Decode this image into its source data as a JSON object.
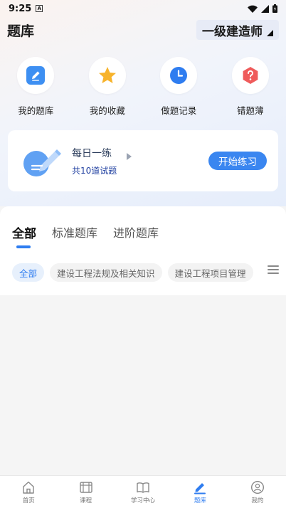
{
  "status_bar": {
    "time": "9:25",
    "notification_letter": "A"
  },
  "header": {
    "title": "题库",
    "level_select": "一级建造师"
  },
  "quick_actions": [
    {
      "label": "我的题库",
      "icon": "pencil-icon"
    },
    {
      "label": "我的收藏",
      "icon": "star-icon"
    },
    {
      "label": "做题记录",
      "icon": "clock-icon"
    },
    {
      "label": "错题薄",
      "icon": "question-icon"
    }
  ],
  "daily": {
    "title": "每日一练",
    "subtitle": "共10道试题",
    "button": "开始练习"
  },
  "bank_tabs": [
    {
      "label": "全部",
      "active": true
    },
    {
      "label": "标准题库",
      "active": false
    },
    {
      "label": "进阶题库",
      "active": false
    }
  ],
  "chips": [
    {
      "label": "全部",
      "active": true
    },
    {
      "label": "建设工程法规及相关知识",
      "active": false
    },
    {
      "label": "建设工程项目管理",
      "active": false
    }
  ],
  "tabbar": [
    {
      "label": "首页",
      "icon": "home-icon",
      "active": false
    },
    {
      "label": "课程",
      "icon": "video-icon",
      "active": false
    },
    {
      "label": "学习中心",
      "icon": "book-icon",
      "active": false
    },
    {
      "label": "题库",
      "icon": "edit-icon",
      "active": true
    },
    {
      "label": "我的",
      "icon": "user-icon",
      "active": false
    }
  ],
  "colors": {
    "accent": "#3a86f0",
    "quiz_blue": "#3d8ff2",
    "star": "#f7b32b",
    "error_red": "#ef5b5b"
  }
}
